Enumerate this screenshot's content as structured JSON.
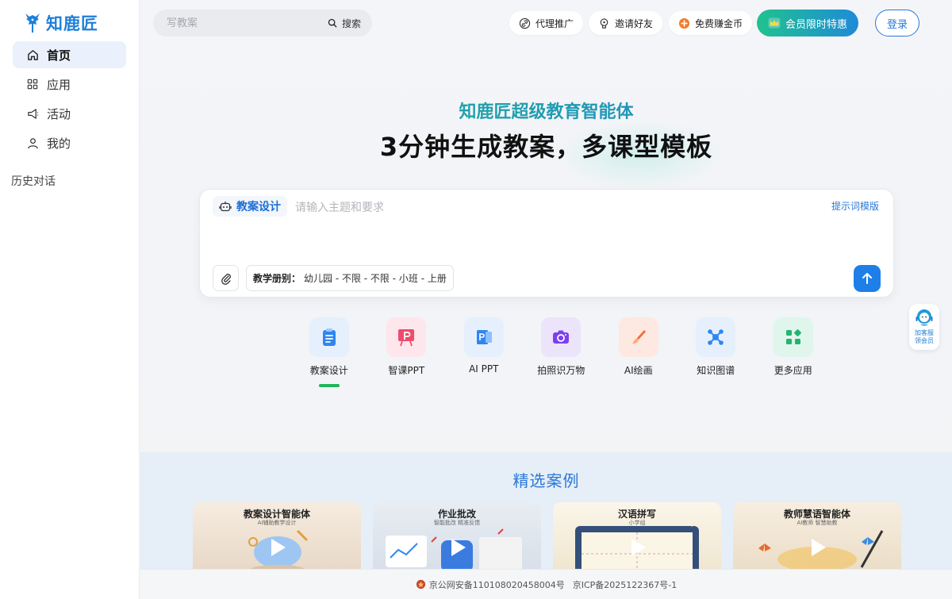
{
  "brand": {
    "name": "知鹿匠"
  },
  "nav": [
    {
      "label": "首页",
      "icon": "home-icon",
      "active": true
    },
    {
      "label": "应用",
      "icon": "grid-icon",
      "active": false
    },
    {
      "label": "活动",
      "icon": "megaphone-icon",
      "active": false
    },
    {
      "label": "我的",
      "icon": "user-icon",
      "active": false
    }
  ],
  "history_title": "历史对话",
  "search": {
    "placeholder": "写教案",
    "button": "搜索"
  },
  "topbar": {
    "agent": "代理推广",
    "invite": "邀请好友",
    "coins": "免费赚金币",
    "vip": "会员限时特惠",
    "login": "登录"
  },
  "hero": {
    "subtitle": "知鹿匠超级教育智能体",
    "title": "3分钟生成教案，多课型模板"
  },
  "composer": {
    "mode": "教案设计",
    "placeholder": "请输入主题和要求",
    "template_link": "提示词模版",
    "grade_label": "教学册别：",
    "grade_value": "幼儿园 - 不限 - 不限 - 小班 - 上册"
  },
  "apps": [
    {
      "label": "教案设计",
      "icon": "lesson-plan-icon",
      "active": true
    },
    {
      "label": "智课PPT",
      "icon": "smart-ppt-icon",
      "active": false
    },
    {
      "label": "AI PPT",
      "icon": "ai-ppt-icon",
      "active": false
    },
    {
      "label": "拍照识万物",
      "icon": "camera-icon",
      "active": false
    },
    {
      "label": "AI绘画",
      "icon": "paintbrush-icon",
      "active": false
    },
    {
      "label": "知识图谱",
      "icon": "knowledge-graph-icon",
      "active": false
    },
    {
      "label": "更多应用",
      "icon": "more-apps-icon",
      "active": false
    }
  ],
  "customer_service": {
    "label_line1": "加客服",
    "label_line2": "领会员"
  },
  "cases": {
    "title": "精选案例",
    "items": [
      {
        "title": "教案设计智能体",
        "subtitle": "AI辅助教学设计"
      },
      {
        "title": "作业批改",
        "subtitle": "智能批改 精准反馈"
      },
      {
        "title": "汉语拼写",
        "subtitle": "小学组"
      },
      {
        "title": "教师慧语智能体",
        "subtitle": "AI教师 智慧助教"
      }
    ]
  },
  "footer": {
    "police": "京公网安备110108020458004号",
    "icp": "京ICP备2025122367号-1"
  },
  "colors": {
    "accent_blue": "#1e7fd8",
    "accent_green": "#22b98a",
    "active_underline": "#22b55a"
  }
}
